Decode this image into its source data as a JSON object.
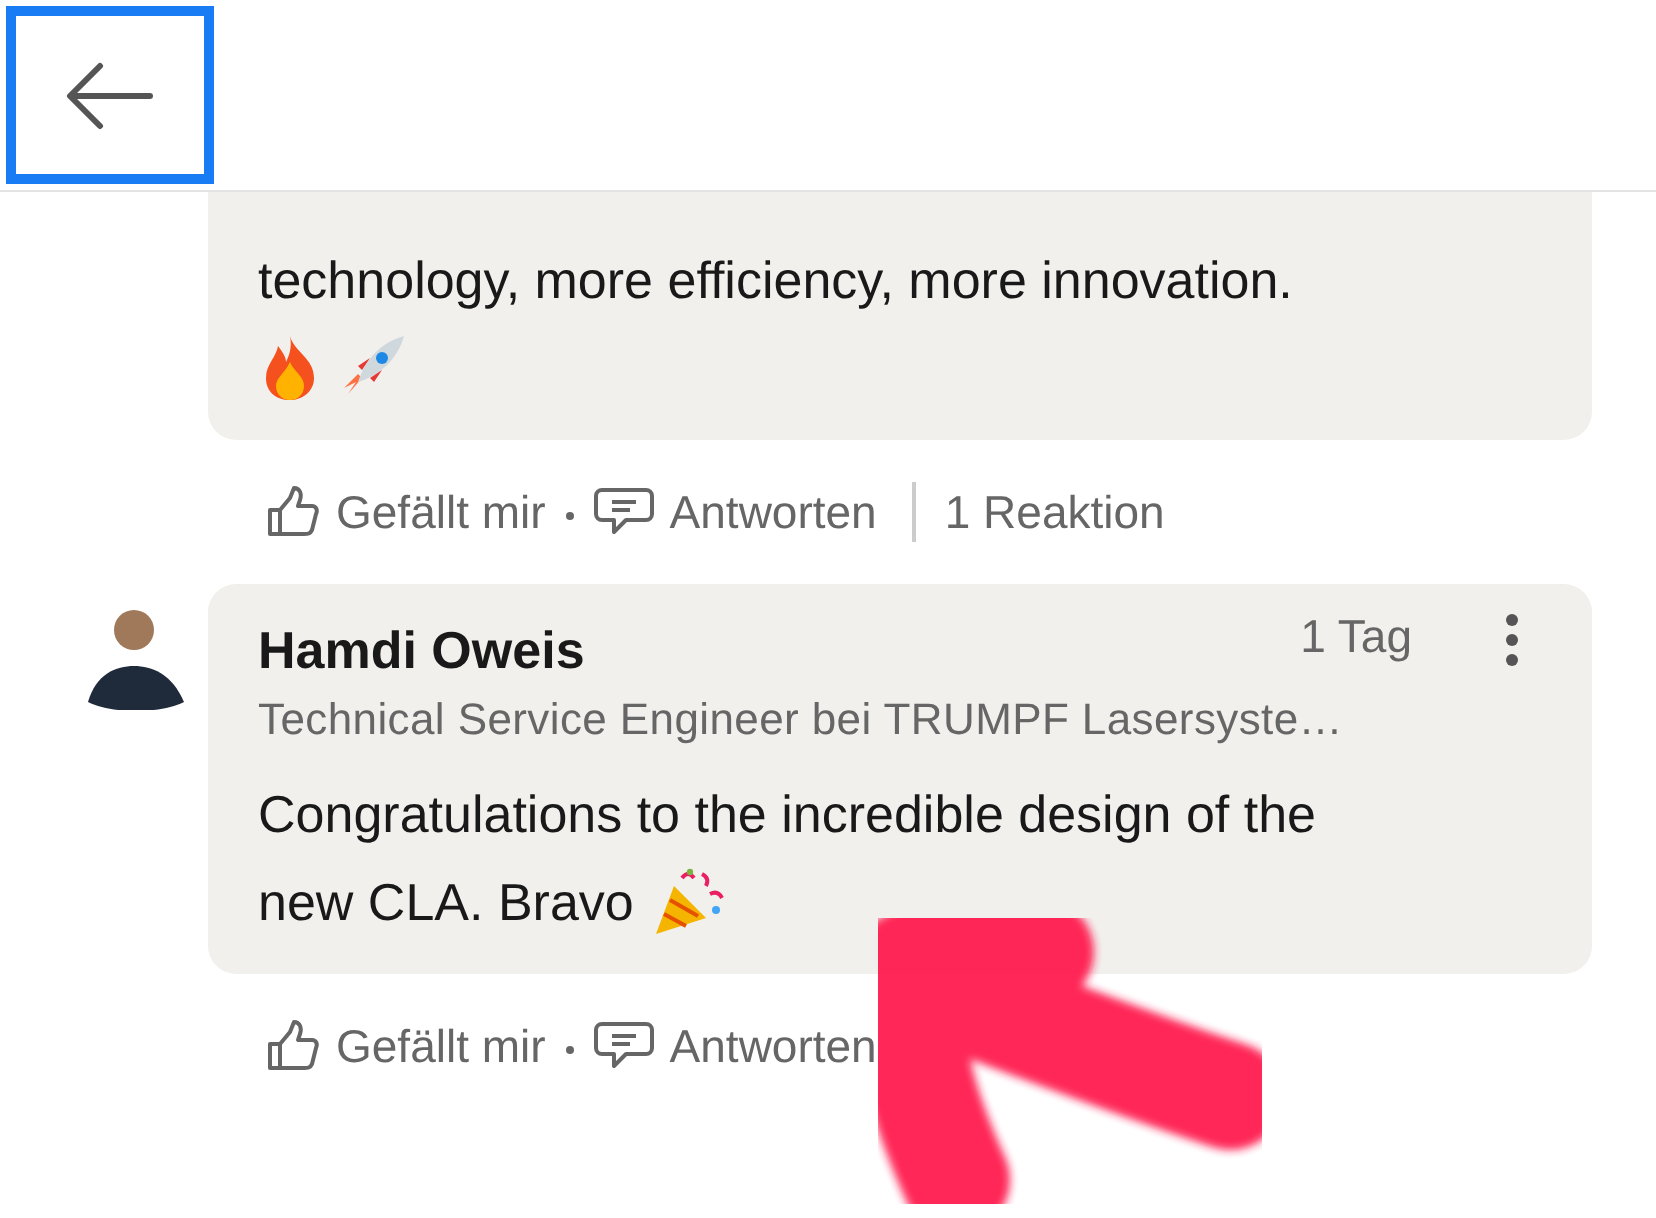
{
  "header": {
    "back_button": {
      "focused": true
    }
  },
  "comments": [
    {
      "lines": [
        [
          {
            "kind": "text",
            "text": "technology, more efficiency, more innovation."
          }
        ],
        [
          {
            "kind": "fire"
          },
          {
            "kind": "rocket"
          }
        ]
      ],
      "actions": [
        {
          "kind": "like",
          "label": "Gefällt mir"
        },
        {
          "kind": "reply",
          "label": "Antworten"
        }
      ],
      "reactions": "1 Reaktion"
    },
    {
      "author": {
        "name": "Hamdi Oweis",
        "headline": "Technical Service Engineer bei TRUMPF Lasersyste…",
        "time": "1 Tag"
      },
      "lines": [
        [
          {
            "kind": "text",
            "text": "Congratulations to the incredible design of the"
          }
        ],
        [
          {
            "kind": "text",
            "text": "new CLA. Bravo"
          },
          {
            "kind": "party"
          }
        ]
      ],
      "actions": [
        {
          "kind": "like",
          "label": "Gefällt mir"
        },
        {
          "kind": "reply",
          "label": "Antworten"
        }
      ]
    }
  ],
  "annotations": [
    {
      "kind": "arrow"
    }
  ]
}
